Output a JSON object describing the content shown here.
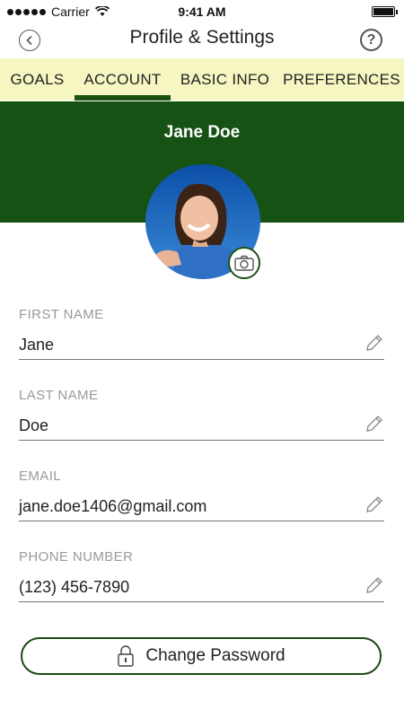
{
  "status_bar": {
    "carrier": "Carrier",
    "time": "9:41 AM"
  },
  "nav": {
    "title": "Profile & Settings",
    "back_icon": "back-icon",
    "help_icon": "help-icon"
  },
  "tabs": [
    {
      "label": "GOALS",
      "active": false
    },
    {
      "label": "ACCOUNT",
      "active": true
    },
    {
      "label": "BASIC INFO",
      "active": false
    },
    {
      "label": "PREFERENCES",
      "active": false
    }
  ],
  "profile": {
    "name": "Jane Doe"
  },
  "fields": {
    "first_name": {
      "label": "FIRST NAME",
      "value": "Jane"
    },
    "last_name": {
      "label": "LAST NAME",
      "value": "Doe"
    },
    "email": {
      "label": "EMAIL",
      "value": "jane.doe1406@gmail.com"
    },
    "phone": {
      "label": "PHONE NUMBER",
      "value": "(123) 456-7890"
    }
  },
  "actions": {
    "change_password": "Change Password"
  },
  "colors": {
    "accent": "#165214",
    "tab_bar": "#f6f6c2",
    "label": "#9a9a9a"
  }
}
